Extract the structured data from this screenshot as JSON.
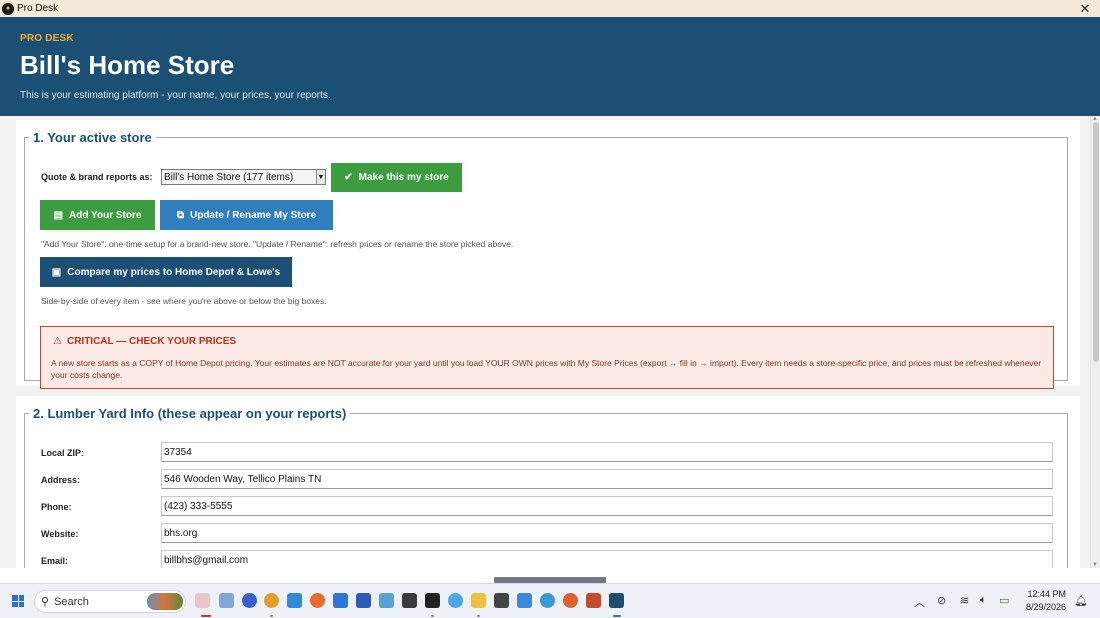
{
  "window": {
    "title": "Pro Desk",
    "close_icon": "close-icon"
  },
  "header": {
    "kicker": "PRO DESK",
    "title": "Bill's Home Store",
    "subtitle": "This is your estimating platform - your name, your prices, your reports."
  },
  "section1": {
    "title": "1.  Your active store",
    "quote_label": "Quote & brand reports as:",
    "store_select_value": "Bill's Home Store  (177 items)",
    "make_my_store_label": "Make this my store",
    "add_store_label": "Add Your Store",
    "update_store_label": "Update / Rename My Store",
    "add_update_hint": "\"Add Your Store\": one-time setup for a brand-new store.  \"Update / Rename\": refresh prices or rename the store picked above.",
    "compare_label": "Compare my prices to Home Depot & Lowe's",
    "compare_hint": "Side-by-side of every item - see where you're above or below the big boxes.",
    "alert_title": "CRITICAL — CHECK YOUR PRICES",
    "alert_body": "A new store starts as a COPY of Home Depot pricing. Your estimates are NOT accurate for your yard until you load YOUR OWN prices with My Store Prices (export → fill in → import). Every item needs a store-specific price, and prices must be refreshed whenever your costs change."
  },
  "section2": {
    "title": "2.  Lumber Yard Info  (these appear on your reports)",
    "fields": [
      {
        "label": "Local ZIP:",
        "value": "37354"
      },
      {
        "label": "Address:",
        "value": "546 Wooden Way, Tellico Plains TN"
      },
      {
        "label": "Phone:",
        "value": "(423) 333-5555"
      },
      {
        "label": "Website:",
        "value": "bhs.org"
      },
      {
        "label": "Email:",
        "value": "billbhs@gmail.com"
      }
    ]
  },
  "taskbar": {
    "search_placeholder": "Search",
    "time": "12:44 PM",
    "date": "8/29/2026"
  },
  "colors": {
    "header_bg": "#1b4f74",
    "accent_orange": "#f0b02c",
    "green_button": "#3c9c40",
    "blue_button": "#2f7fbd",
    "navy_button": "#1b4f74",
    "alert_border": "#c8472f",
    "alert_bg": "#fbe9e6"
  }
}
